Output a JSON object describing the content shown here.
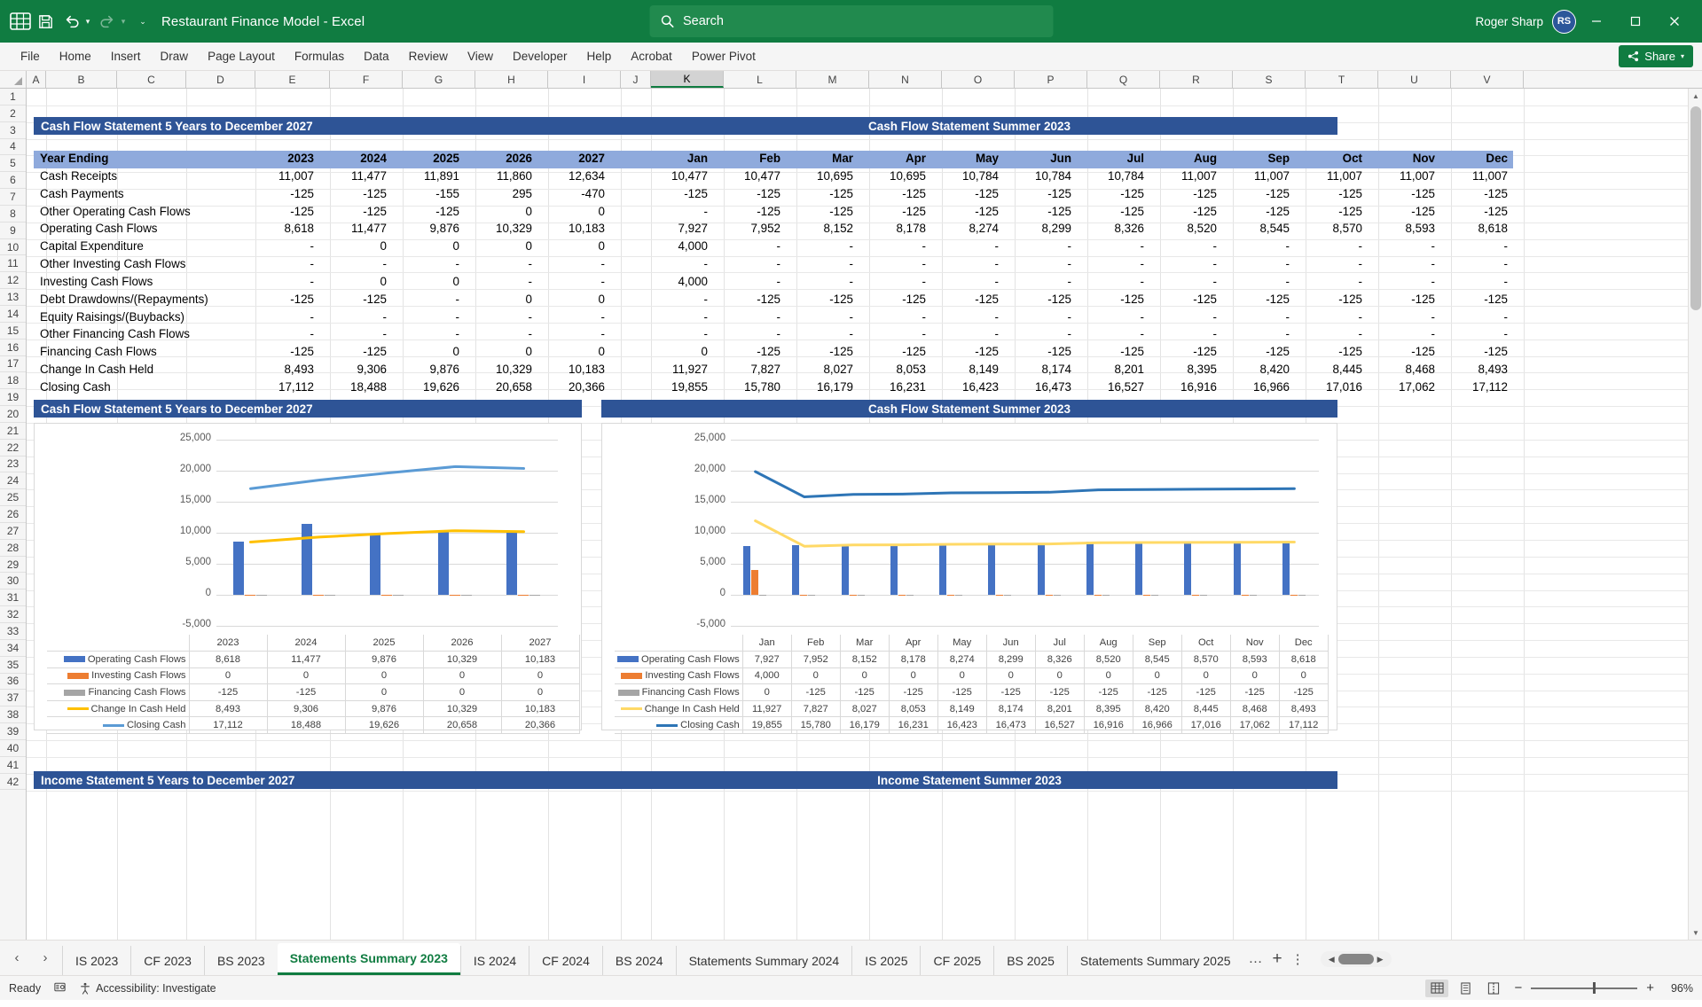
{
  "titlebar": {
    "doc_title": "Restaurant Finance Model  -  Excel",
    "search_placeholder": "Search",
    "user_name": "Roger Sharp",
    "avatar_initials": "RS",
    "icons": {
      "save": "save-icon",
      "undo": "undo-icon",
      "redo": "redo-icon",
      "customize": "customize-quick-access-icon"
    }
  },
  "ribbon": {
    "tabs": [
      "File",
      "Home",
      "Insert",
      "Draw",
      "Page Layout",
      "Formulas",
      "Data",
      "Review",
      "View",
      "Developer",
      "Help",
      "Acrobat",
      "Power Pivot"
    ],
    "share_label": "Share"
  },
  "grid": {
    "columns": [
      "A",
      "B",
      "C",
      "D",
      "E",
      "F",
      "G",
      "H",
      "I",
      "J",
      "K",
      "L",
      "M",
      "N",
      "O",
      "P",
      "Q",
      "R",
      "S",
      "T",
      "U",
      "V"
    ],
    "selected_column": "K",
    "rows": [
      1,
      2,
      3,
      4,
      5,
      6,
      7,
      8,
      9,
      10,
      11,
      12,
      13,
      14,
      15,
      16,
      17,
      18,
      19,
      20,
      21,
      22,
      23,
      24,
      25,
      26,
      27,
      28,
      29,
      30,
      31,
      32,
      33,
      34,
      35,
      36,
      37,
      38,
      39,
      40,
      41,
      42
    ]
  },
  "banners": {
    "cf_years": "Cash Flow Statement 5 Years to December 2027",
    "cf_summer": "Cash Flow Statement Summer 2023",
    "is_years": "Income Statement 5 Years to December 2027",
    "is_summer": "Income Statement Summer 2023"
  },
  "cashflow_table": {
    "row_label_header": "Year Ending",
    "year_headers": [
      "2023",
      "2024",
      "2025",
      "2026",
      "2027"
    ],
    "month_headers": [
      "Jan",
      "Feb",
      "Mar",
      "Apr",
      "May",
      "Jun",
      "Jul",
      "Aug",
      "Sep",
      "Oct",
      "Nov",
      "Dec"
    ],
    "rows": [
      {
        "label": "Cash Receipts",
        "years": [
          "11,007",
          "11,477",
          "11,891",
          "11,860",
          "12,634"
        ],
        "months": [
          "10,477",
          "10,477",
          "10,695",
          "10,695",
          "10,784",
          "10,784",
          "10,784",
          "11,007",
          "11,007",
          "11,007",
          "11,007",
          "11,007"
        ]
      },
      {
        "label": "Cash Payments",
        "years": [
          "-125",
          "-125",
          "-155",
          "295",
          "-470"
        ],
        "months": [
          "-125",
          "-125",
          "-125",
          "-125",
          "-125",
          "-125",
          "-125",
          "-125",
          "-125",
          "-125",
          "-125",
          "-125"
        ]
      },
      {
        "label": "Other Operating Cash Flows",
        "years": [
          "-125",
          "-125",
          "-125",
          "0",
          "0"
        ],
        "months": [
          "-",
          "-125",
          "-125",
          "-125",
          "-125",
          "-125",
          "-125",
          "-125",
          "-125",
          "-125",
          "-125",
          "-125"
        ]
      },
      {
        "label": "Operating Cash Flows",
        "years": [
          "8,618",
          "11,477",
          "9,876",
          "10,329",
          "10,183"
        ],
        "months": [
          "7,927",
          "7,952",
          "8,152",
          "8,178",
          "8,274",
          "8,299",
          "8,326",
          "8,520",
          "8,545",
          "8,570",
          "8,593",
          "8,618"
        ]
      },
      {
        "label": "Capital Expenditure",
        "years": [
          "-",
          "0",
          "0",
          "0",
          "0"
        ],
        "months": [
          "4,000",
          "-",
          "-",
          "-",
          "-",
          "-",
          "-",
          "-",
          "-",
          "-",
          "-",
          "-"
        ]
      },
      {
        "label": "Other Investing Cash Flows",
        "years": [
          "-",
          "-",
          "-",
          "-",
          "-"
        ],
        "months": [
          "-",
          "-",
          "-",
          "-",
          "-",
          "-",
          "-",
          "-",
          "-",
          "-",
          "-",
          "-"
        ]
      },
      {
        "label": "Investing Cash Flows",
        "years": [
          "-",
          "0",
          "0",
          "-",
          "-"
        ],
        "months": [
          "4,000",
          "-",
          "-",
          "-",
          "-",
          "-",
          "-",
          "-",
          "-",
          "-",
          "-",
          "-"
        ]
      },
      {
        "label": "Debt Drawdowns/(Repayments)",
        "years": [
          "-125",
          "-125",
          "-",
          "0",
          "0"
        ],
        "months": [
          "-",
          "-125",
          "-125",
          "-125",
          "-125",
          "-125",
          "-125",
          "-125",
          "-125",
          "-125",
          "-125",
          "-125"
        ]
      },
      {
        "label": "Equity Raisings/(Buybacks)",
        "years": [
          "-",
          "-",
          "-",
          "-",
          "-"
        ],
        "months": [
          "-",
          "-",
          "-",
          "-",
          "-",
          "-",
          "-",
          "-",
          "-",
          "-",
          "-",
          "-"
        ]
      },
      {
        "label": "Other Financing Cash Flows",
        "years": [
          "-",
          "-",
          "-",
          "-",
          "-"
        ],
        "months": [
          "-",
          "-",
          "-",
          "-",
          "-",
          "-",
          "-",
          "-",
          "-",
          "-",
          "-",
          "-"
        ]
      },
      {
        "label": "Financing Cash Flows",
        "years": [
          "-125",
          "-125",
          "0",
          "0",
          "0"
        ],
        "months": [
          "0",
          "-125",
          "-125",
          "-125",
          "-125",
          "-125",
          "-125",
          "-125",
          "-125",
          "-125",
          "-125",
          "-125"
        ]
      },
      {
        "label": "Change In Cash Held",
        "years": [
          "8,493",
          "9,306",
          "9,876",
          "10,329",
          "10,183"
        ],
        "months": [
          "11,927",
          "7,827",
          "8,027",
          "8,053",
          "8,149",
          "8,174",
          "8,201",
          "8,395",
          "8,420",
          "8,445",
          "8,468",
          "8,493"
        ]
      },
      {
        "label": "Closing Cash",
        "years": [
          "17,112",
          "18,488",
          "19,626",
          "20,658",
          "20,366"
        ],
        "months": [
          "19,855",
          "15,780",
          "16,179",
          "16,231",
          "16,423",
          "16,473",
          "16,527",
          "16,916",
          "16,966",
          "17,016",
          "17,062",
          "17,112"
        ]
      }
    ]
  },
  "chart_data": [
    {
      "id": "chart-cf-years",
      "type": "bar",
      "title": "Cash Flow Statement 5 Years to December 2027",
      "categories": [
        "2023",
        "2024",
        "2025",
        "2026",
        "2027"
      ],
      "ylim": [
        -5000,
        25000
      ],
      "yticks": [
        "-5,000",
        "0",
        "5,000",
        "10,000",
        "15,000",
        "20,000",
        "25,000"
      ],
      "ytick_values": [
        -5000,
        0,
        5000,
        10000,
        15000,
        20000,
        25000
      ],
      "grid": true,
      "legend": "bottom-table",
      "series": [
        {
          "name": "Operating Cash Flows",
          "kind": "bar",
          "color": "#4472c4",
          "values": [
            8618,
            11477,
            9876,
            10329,
            10183
          ],
          "labels": [
            "8,618",
            "11,477",
            "9,876",
            "10,329",
            "10,183"
          ]
        },
        {
          "name": "Investing Cash Flows",
          "kind": "bar",
          "color": "#ed7d31",
          "values": [
            0,
            0,
            0,
            0,
            0
          ],
          "labels": [
            "0",
            "0",
            "0",
            "0",
            "0"
          ]
        },
        {
          "name": "Financing Cash Flows",
          "kind": "bar",
          "color": "#a5a5a5",
          "values": [
            -125,
            -125,
            0,
            0,
            0
          ],
          "labels": [
            "-125",
            "-125",
            "0",
            "0",
            "0"
          ]
        },
        {
          "name": "Change In Cash Held",
          "kind": "line",
          "color": "#ffc000",
          "values": [
            8493,
            9306,
            9876,
            10329,
            10183
          ],
          "labels": [
            "8,493",
            "9,306",
            "9,876",
            "10,329",
            "10,183"
          ]
        },
        {
          "name": "Closing Cash",
          "kind": "line",
          "color": "#5b9bd5",
          "values": [
            17112,
            18488,
            19626,
            20658,
            20366
          ],
          "labels": [
            "17,112",
            "18,488",
            "19,626",
            "20,658",
            "20,366"
          ]
        }
      ]
    },
    {
      "id": "chart-cf-summer",
      "type": "bar",
      "title": "Cash Flow Statement Summer 2023",
      "categories": [
        "Jan",
        "Feb",
        "Mar",
        "Apr",
        "May",
        "Jun",
        "Jul",
        "Aug",
        "Sep",
        "Oct",
        "Nov",
        "Dec"
      ],
      "ylim": [
        -5000,
        25000
      ],
      "yticks": [
        "-5,000",
        "0",
        "5,000",
        "10,000",
        "15,000",
        "20,000",
        "25,000"
      ],
      "ytick_values": [
        -5000,
        0,
        5000,
        10000,
        15000,
        20000,
        25000
      ],
      "grid": true,
      "legend": "bottom-table",
      "series": [
        {
          "name": "Operating Cash Flows",
          "kind": "bar",
          "color": "#4472c4",
          "values": [
            7927,
            7952,
            8152,
            8178,
            8274,
            8299,
            8326,
            8520,
            8545,
            8570,
            8593,
            8618
          ],
          "labels": [
            "7,927",
            "7,952",
            "8,152",
            "8,178",
            "8,274",
            "8,299",
            "8,326",
            "8,520",
            "8,545",
            "8,570",
            "8,593",
            "8,618"
          ]
        },
        {
          "name": "Investing Cash Flows",
          "kind": "bar",
          "color": "#ed7d31",
          "values": [
            4000,
            0,
            0,
            0,
            0,
            0,
            0,
            0,
            0,
            0,
            0,
            0
          ],
          "labels": [
            "4,000",
            "0",
            "0",
            "0",
            "0",
            "0",
            "0",
            "0",
            "0",
            "0",
            "0",
            "0"
          ]
        },
        {
          "name": "Financing Cash Flows",
          "kind": "bar",
          "color": "#a5a5a5",
          "values": [
            0,
            -125,
            -125,
            -125,
            -125,
            -125,
            -125,
            -125,
            -125,
            -125,
            -125,
            -125
          ],
          "labels": [
            "0",
            "-125",
            "-125",
            "-125",
            "-125",
            "-125",
            "-125",
            "-125",
            "-125",
            "-125",
            "-125",
            "-125"
          ]
        },
        {
          "name": "Change In Cash Held",
          "kind": "line",
          "color": "#ffd966",
          "values": [
            11927,
            7827,
            8027,
            8053,
            8149,
            8174,
            8201,
            8395,
            8420,
            8445,
            8468,
            8493
          ],
          "labels": [
            "11,927",
            "7,827",
            "8,027",
            "8,053",
            "8,149",
            "8,174",
            "8,201",
            "8,395",
            "8,420",
            "8,445",
            "8,468",
            "8,493"
          ]
        },
        {
          "name": "Closing Cash",
          "kind": "line",
          "color": "#2e75b6",
          "values": [
            19855,
            15780,
            16179,
            16231,
            16423,
            16473,
            16527,
            16916,
            16966,
            17016,
            17062,
            17112
          ],
          "labels": [
            "19,855",
            "15,780",
            "16,179",
            "16,231",
            "16,423",
            "16,473",
            "16,527",
            "16,916",
            "16,966",
            "17,016",
            "17,062",
            "17,112"
          ]
        }
      ]
    }
  ],
  "sheet_tabs": {
    "items": [
      "IS 2023",
      "CF 2023",
      "BS 2023",
      "Statements Summary 2023",
      "IS 2024",
      "CF 2024",
      "BS 2024",
      "Statements Summary 2024",
      "IS 2025",
      "CF 2025",
      "BS 2025",
      "Statements Summary 2025"
    ],
    "active": "Statements Summary 2023",
    "overflow_label": "…"
  },
  "statusbar": {
    "ready": "Ready",
    "accessibility": "Accessibility: Investigate",
    "zoom": "96%"
  }
}
